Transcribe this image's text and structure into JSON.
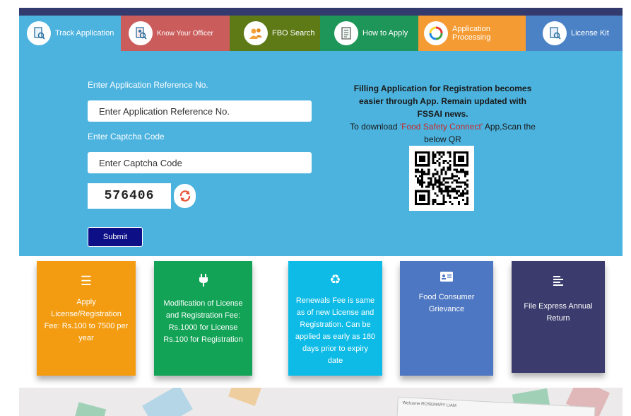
{
  "tabs": [
    {
      "label": "Track Application",
      "icon": "document-search-icon",
      "color": "#4cb3df"
    },
    {
      "label": "Know Your Officer",
      "icon": "officer-search-icon",
      "color": "#ca5d5b"
    },
    {
      "label": "FBO Search",
      "icon": "users-icon",
      "color": "#5e7a16"
    },
    {
      "label": "How to Apply",
      "icon": "checklist-icon",
      "color": "#1f9659"
    },
    {
      "label": "Application Processing",
      "icon": "process-circle-icon",
      "color": "#f59b33"
    },
    {
      "label": "License Kit",
      "icon": "license-kit-icon",
      "color": "#4b82c6"
    }
  ],
  "form": {
    "ref_label": "Enter Application Reference No.",
    "ref_placeholder": "Enter Application Reference No.",
    "captcha_label": "Enter Captcha Code",
    "captcha_placeholder": "Enter Captcha Code",
    "captcha_value": "576406",
    "submit_label": "Submit"
  },
  "info": {
    "line_bold": "Filling Application for Registration becomes easier through App. Remain updated with FSSAI news.",
    "prefix": "To download ",
    "app_name": "'Food Safety Connect'",
    "suffix": " App,Scan the below QR"
  },
  "cards": [
    {
      "text": "Apply License/Registration Fee: Rs.100 to 7500 per year",
      "icon": "menu-lines-icon",
      "color": "#f39c12"
    },
    {
      "text": "Modification of License and Registration Fee: Rs.1000 for License Rs.100 for Registration",
      "icon": "plug-icon",
      "color": "#13a356"
    },
    {
      "text": "Renewals Fee is same as of new License and Registration. Can be applied as early as 180 days prior to expiry date",
      "icon": "recycle-icon",
      "color": "#0dbbe6"
    },
    {
      "text": "Food Consumer Grievance",
      "icon": "id-card-icon",
      "color": "#4d77c2"
    },
    {
      "text": "File Express Annual Return",
      "icon": "align-left-icon",
      "color": "#3b3b6d"
    }
  ],
  "bottom": {
    "welcome": "Welcome ROSEMARY LIAM"
  }
}
